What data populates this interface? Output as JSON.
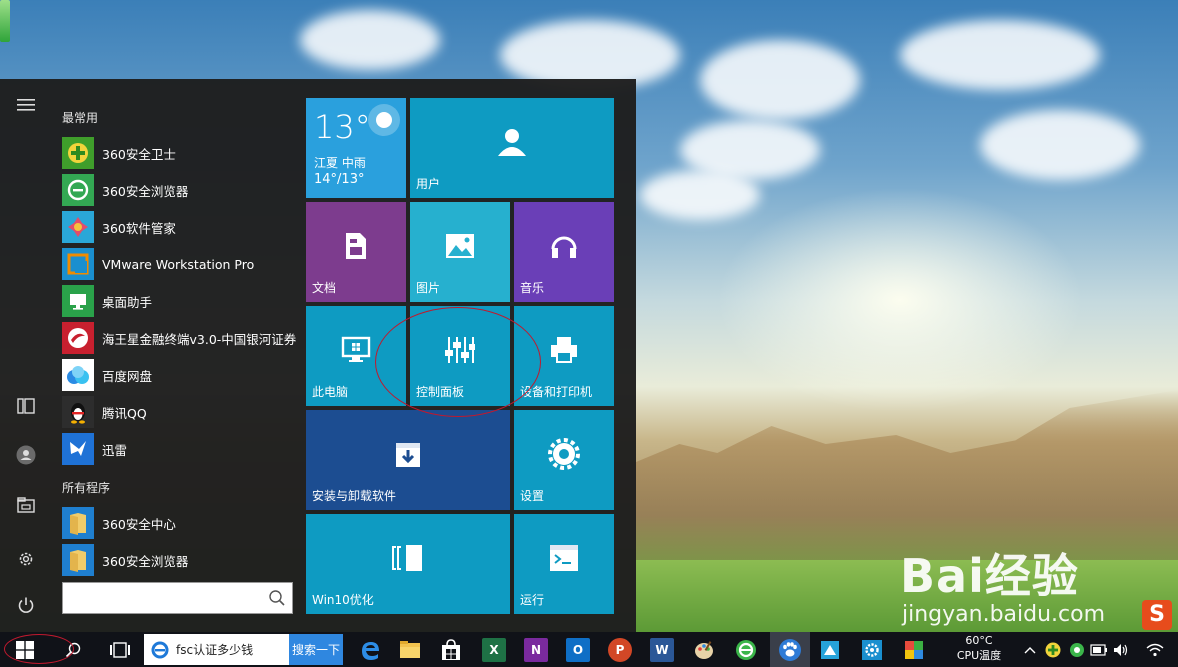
{
  "start_menu": {
    "most_used_label": "最常用",
    "all_programs_label": "所有程序",
    "most_used": [
      {
        "label": "360安全卫士",
        "icon": "plus",
        "color": "#3f9e2b"
      },
      {
        "label": "360安全浏览器",
        "icon": "e",
        "color": "#33a853"
      },
      {
        "label": "360软件管家",
        "icon": "grid",
        "color": "#e34d6b"
      },
      {
        "label": "VMware Workstation Pro",
        "icon": "vm",
        "color": "#f08b00"
      },
      {
        "label": "桌面助手",
        "icon": "desk",
        "color": "#2aa24a"
      },
      {
        "label": "海王星金融终端v3.0-中国银河证券",
        "icon": "star",
        "color": "#c8202f"
      },
      {
        "label": "百度网盘",
        "icon": "cloud",
        "color": "#2a8be4"
      },
      {
        "label": "腾讯QQ",
        "icon": "qq",
        "color": "#222222"
      },
      {
        "label": "迅雷",
        "icon": "bird",
        "color": "#1f72d6"
      }
    ],
    "all_programs": [
      {
        "label": "360安全中心",
        "icon": "folder",
        "color": "#e8c15a"
      },
      {
        "label": "360安全浏览器",
        "icon": "folder",
        "color": "#e8c15a"
      }
    ],
    "search_placeholder": ""
  },
  "tiles": {
    "weather": {
      "temp": "13°",
      "city": "江夏  中雨",
      "range": "14°/13°"
    },
    "user": "用户",
    "documents": "文档",
    "pictures": "图片",
    "music": "音乐",
    "this_pc": "此电脑",
    "control_panel": "控制面板",
    "devices_printers": "设备和打印机",
    "install_uninstall": "安装与卸载软件",
    "settings": "设置",
    "win10_optimize": "Win10优化",
    "run": "运行"
  },
  "taskbar": {
    "search_text": "fsc认证多少钱",
    "search_button": "搜索一下",
    "cpu_temp": "60°C",
    "cpu_label": "CPU温度"
  },
  "watermark": {
    "brand": "Bai经验",
    "url": "jingyan.baidu.com"
  },
  "colors": {
    "tile_teal": "#0e9bc2",
    "tile_cyan": "#26b0cf",
    "tile_purple_doc": "#7d3c8e",
    "tile_purple_music": "#6a3fb7",
    "tile_navy": "#1c4d91",
    "annotation_red": "#c0192e",
    "taskbar": "#101218"
  }
}
